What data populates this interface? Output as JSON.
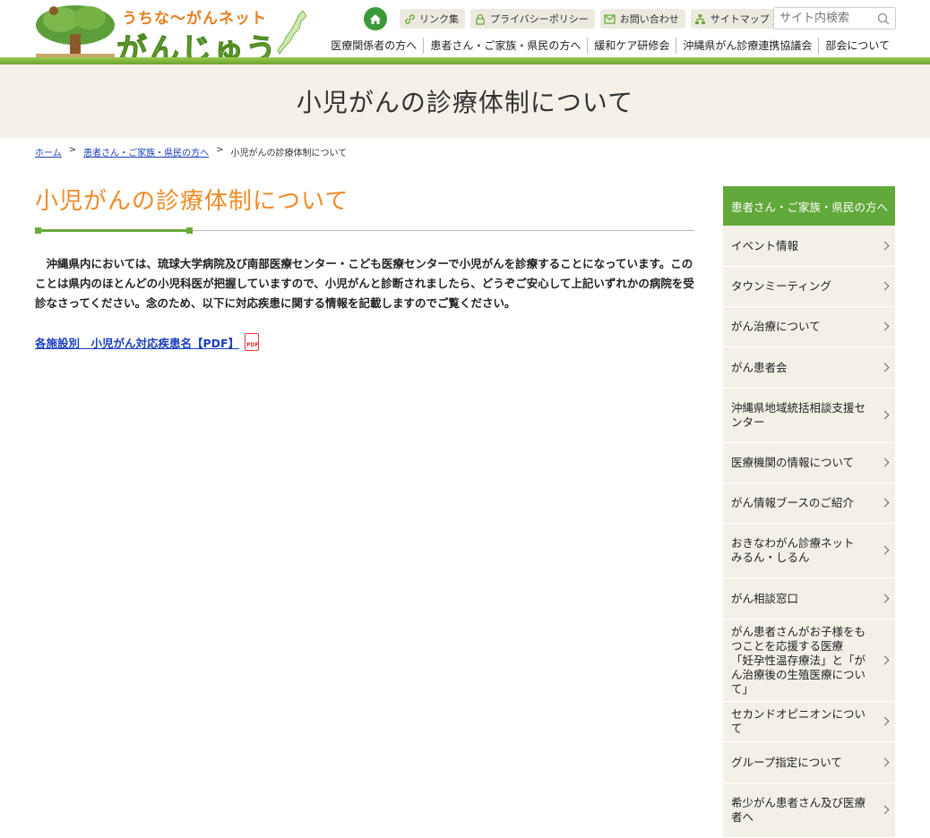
{
  "header": {
    "logo_sub": "うちな～がんネット",
    "logo_main": "がんじゅう",
    "utility_links": [
      {
        "label": "リンク集",
        "icon": "link-icon"
      },
      {
        "label": "プライバシーポリシー",
        "icon": "lock-icon"
      },
      {
        "label": "お問い合わせ",
        "icon": "mail-icon"
      },
      {
        "label": "サイトマップ",
        "icon": "sitemap-icon"
      }
    ],
    "search_placeholder": "サイト内検索",
    "gnav": [
      "医療関係者の方へ",
      "患者さん・ご家族・県民の方へ",
      "緩和ケア研修会",
      "沖縄県がん診療連携協議会",
      "部会について"
    ]
  },
  "page_title": "小児がんの診療体制について",
  "breadcrumb": {
    "home": "ホーム",
    "parent": "患者さん・ご家族・県民の方へ",
    "current": "小児がんの診療体制について",
    "separator": ">"
  },
  "main": {
    "heading": "小児がんの診療体制について",
    "lead": "沖縄県内においては、琉球大学病院及び南部医療センター・こども医療センターで小児がんを診療することになっています。このことは県内のほとんどの小児科医が把握していますので、小児がんと診断されましたら、どうぞご安心して上記いずれかの病院を受診なさってください。念のため、以下に対応疾患に関する情報を記載しますのでご覧ください。",
    "pdf_link": "各施設別　小児がん対応疾患名【PDF】",
    "pdf_icon_text": "PDF"
  },
  "sidebar": {
    "heading": "患者さん・ご家族・県民の方へ",
    "items": [
      "イベント情報",
      "タウンミーティング",
      "がん治療について",
      "がん患者会",
      "沖縄県地域統括相談支援センター",
      "医療機関の情報について",
      "がん情報ブースのご紹介",
      "おきなわがん診療ネット　みるん・しるん",
      "がん相談窓口",
      "がん患者さんがお子様をもつことを応援する医療　「妊孕性温存療法」と「がん治療後の生殖医療について」",
      "セカンドオピニオンについて",
      "グループ指定について",
      "希少がん患者さん及び医療者へ"
    ]
  },
  "colors": {
    "accent_green": "#63a83a",
    "heading_orange": "#f08a24",
    "title_band_bg": "#f5f1e8",
    "link_blue": "#1a3ebd"
  }
}
